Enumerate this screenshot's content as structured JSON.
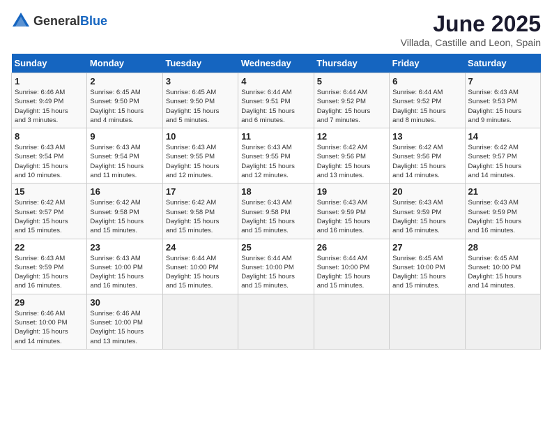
{
  "header": {
    "logo_general": "General",
    "logo_blue": "Blue",
    "month_title": "June 2025",
    "location": "Villada, Castille and Leon, Spain"
  },
  "days_of_week": [
    "Sunday",
    "Monday",
    "Tuesday",
    "Wednesday",
    "Thursday",
    "Friday",
    "Saturday"
  ],
  "weeks": [
    [
      {
        "day": "1",
        "sunrise": "6:46 AM",
        "sunset": "9:49 PM",
        "daylight": "15 hours and 3 minutes."
      },
      {
        "day": "2",
        "sunrise": "6:45 AM",
        "sunset": "9:50 PM",
        "daylight": "15 hours and 4 minutes."
      },
      {
        "day": "3",
        "sunrise": "6:45 AM",
        "sunset": "9:50 PM",
        "daylight": "15 hours and 5 minutes."
      },
      {
        "day": "4",
        "sunrise": "6:44 AM",
        "sunset": "9:51 PM",
        "daylight": "15 hours and 6 minutes."
      },
      {
        "day": "5",
        "sunrise": "6:44 AM",
        "sunset": "9:52 PM",
        "daylight": "15 hours and 7 minutes."
      },
      {
        "day": "6",
        "sunrise": "6:44 AM",
        "sunset": "9:52 PM",
        "daylight": "15 hours and 8 minutes."
      },
      {
        "day": "7",
        "sunrise": "6:43 AM",
        "sunset": "9:53 PM",
        "daylight": "15 hours and 9 minutes."
      }
    ],
    [
      {
        "day": "8",
        "sunrise": "6:43 AM",
        "sunset": "9:54 PM",
        "daylight": "15 hours and 10 minutes."
      },
      {
        "day": "9",
        "sunrise": "6:43 AM",
        "sunset": "9:54 PM",
        "daylight": "15 hours and 11 minutes."
      },
      {
        "day": "10",
        "sunrise": "6:43 AM",
        "sunset": "9:55 PM",
        "daylight": "15 hours and 12 minutes."
      },
      {
        "day": "11",
        "sunrise": "6:43 AM",
        "sunset": "9:55 PM",
        "daylight": "15 hours and 12 minutes."
      },
      {
        "day": "12",
        "sunrise": "6:42 AM",
        "sunset": "9:56 PM",
        "daylight": "15 hours and 13 minutes."
      },
      {
        "day": "13",
        "sunrise": "6:42 AM",
        "sunset": "9:56 PM",
        "daylight": "15 hours and 14 minutes."
      },
      {
        "day": "14",
        "sunrise": "6:42 AM",
        "sunset": "9:57 PM",
        "daylight": "15 hours and 14 minutes."
      }
    ],
    [
      {
        "day": "15",
        "sunrise": "6:42 AM",
        "sunset": "9:57 PM",
        "daylight": "15 hours and 15 minutes."
      },
      {
        "day": "16",
        "sunrise": "6:42 AM",
        "sunset": "9:58 PM",
        "daylight": "15 hours and 15 minutes."
      },
      {
        "day": "17",
        "sunrise": "6:42 AM",
        "sunset": "9:58 PM",
        "daylight": "15 hours and 15 minutes."
      },
      {
        "day": "18",
        "sunrise": "6:43 AM",
        "sunset": "9:58 PM",
        "daylight": "15 hours and 15 minutes."
      },
      {
        "day": "19",
        "sunrise": "6:43 AM",
        "sunset": "9:59 PM",
        "daylight": "15 hours and 16 minutes."
      },
      {
        "day": "20",
        "sunrise": "6:43 AM",
        "sunset": "9:59 PM",
        "daylight": "15 hours and 16 minutes."
      },
      {
        "day": "21",
        "sunrise": "6:43 AM",
        "sunset": "9:59 PM",
        "daylight": "15 hours and 16 minutes."
      }
    ],
    [
      {
        "day": "22",
        "sunrise": "6:43 AM",
        "sunset": "9:59 PM",
        "daylight": "15 hours and 16 minutes."
      },
      {
        "day": "23",
        "sunrise": "6:43 AM",
        "sunset": "10:00 PM",
        "daylight": "15 hours and 16 minutes."
      },
      {
        "day": "24",
        "sunrise": "6:44 AM",
        "sunset": "10:00 PM",
        "daylight": "15 hours and 15 minutes."
      },
      {
        "day": "25",
        "sunrise": "6:44 AM",
        "sunset": "10:00 PM",
        "daylight": "15 hours and 15 minutes."
      },
      {
        "day": "26",
        "sunrise": "6:44 AM",
        "sunset": "10:00 PM",
        "daylight": "15 hours and 15 minutes."
      },
      {
        "day": "27",
        "sunrise": "6:45 AM",
        "sunset": "10:00 PM",
        "daylight": "15 hours and 15 minutes."
      },
      {
        "day": "28",
        "sunrise": "6:45 AM",
        "sunset": "10:00 PM",
        "daylight": "15 hours and 14 minutes."
      }
    ],
    [
      {
        "day": "29",
        "sunrise": "6:46 AM",
        "sunset": "10:00 PM",
        "daylight": "15 hours and 14 minutes."
      },
      {
        "day": "30",
        "sunrise": "6:46 AM",
        "sunset": "10:00 PM",
        "daylight": "15 hours and 13 minutes."
      },
      null,
      null,
      null,
      null,
      null
    ]
  ]
}
